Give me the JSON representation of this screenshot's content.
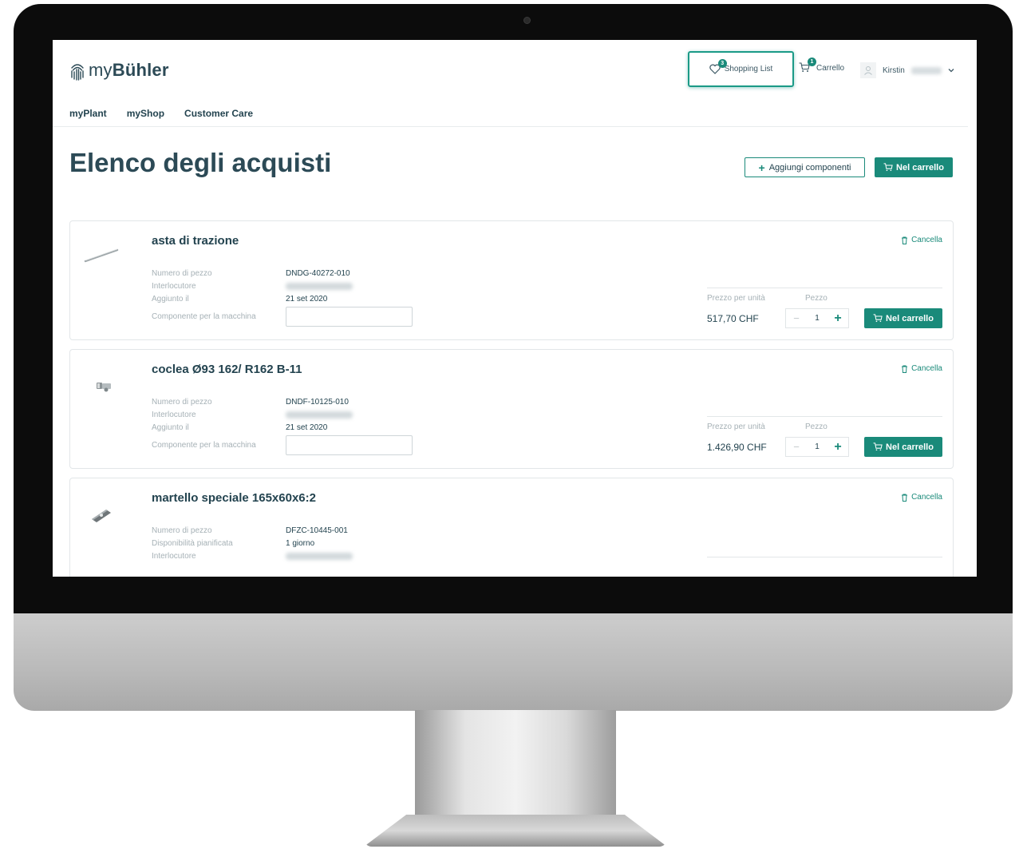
{
  "header": {
    "logo_prefix": "my",
    "logo_bold": "Bühler",
    "shopping_list_label": "Shopping List",
    "shopping_list_count": "3",
    "cart_label": "Carrello",
    "cart_count": "1",
    "user_name": "Kirstin"
  },
  "nav": {
    "items": [
      "myPlant",
      "myShop",
      "Customer Care"
    ]
  },
  "page": {
    "title": "Elenco degli acquisti",
    "add_components_label": "Aggiungi componenti",
    "to_cart_label": "Nel carrello"
  },
  "labels": {
    "part_number": "Numero di pezzo",
    "contact": "Interlocutore",
    "added_on": "Aggiunto il",
    "availability": "Disponibilità pianificata",
    "machine_component": "Componente per la macchina",
    "unit_price": "Prezzo per unità",
    "pieces": "Pezzo",
    "delete": "Cancella",
    "add_to_cart": "Nel carrello"
  },
  "items": [
    {
      "name": "asta di trazione",
      "part_number": "DNDG-40272-010",
      "added_on": "21 set 2020",
      "price": "517,70 CHF",
      "quantity": "1"
    },
    {
      "name": "coclea Ø93 162/ R162 B-11",
      "part_number": "DNDF-10125-010",
      "added_on": "21 set 2020",
      "price": "1.426,90 CHF",
      "quantity": "1"
    },
    {
      "name": "martello speciale 165x60x6:2",
      "part_number": "DFZC-10445-001",
      "availability": "1 giorno"
    }
  ],
  "colors": {
    "accent": "#1a8a7a",
    "text": "#23434f",
    "bezel": "#0c0c0c"
  }
}
